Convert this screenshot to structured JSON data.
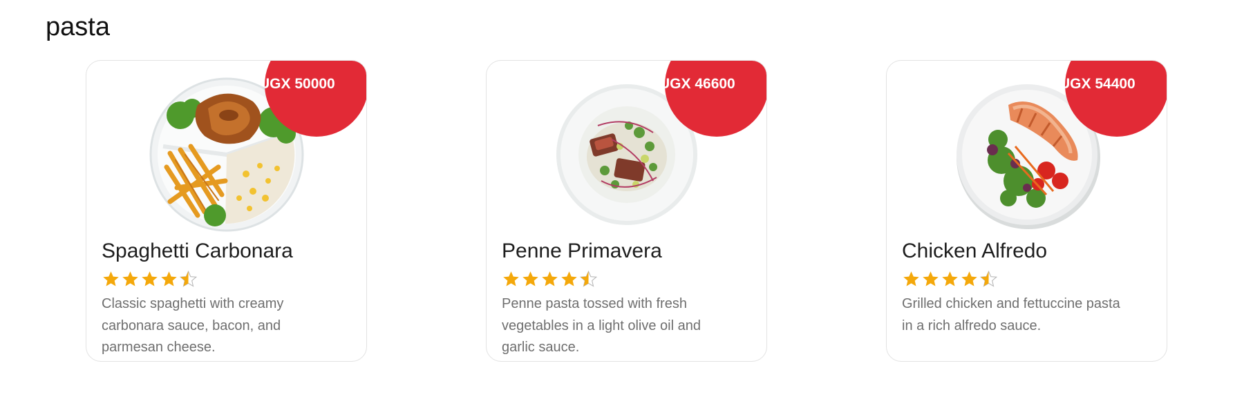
{
  "category": {
    "title": "pasta"
  },
  "colors": {
    "badge": "#e22a36",
    "star_filled": "#f4a80b",
    "star_empty": "#c7c7c7",
    "text_muted": "#6e6e6e"
  },
  "cards": [
    {
      "price": "UGX 50000",
      "name": "Spaghetti Carbonara",
      "rating": 4.5,
      "description": "Classic spaghetti with creamy carbonara sauce, bacon, and parmesan cheese.",
      "image_icon": "roast-chicken-fries-rice-plate-image"
    },
    {
      "price": "UGX 46600",
      "name": "Penne Primavera",
      "rating": 4.5,
      "description": "Penne pasta tossed with fresh vegetables in a light olive oil and garlic sauce.",
      "image_icon": "seared-tuna-salad-bowl-image"
    },
    {
      "price": "UGX 54400",
      "name": "Chicken Alfredo",
      "rating": 4.5,
      "description": "Grilled chicken and fettuccine pasta in a rich alfredo sauce.",
      "image_icon": "salmon-salad-plate-image"
    }
  ]
}
